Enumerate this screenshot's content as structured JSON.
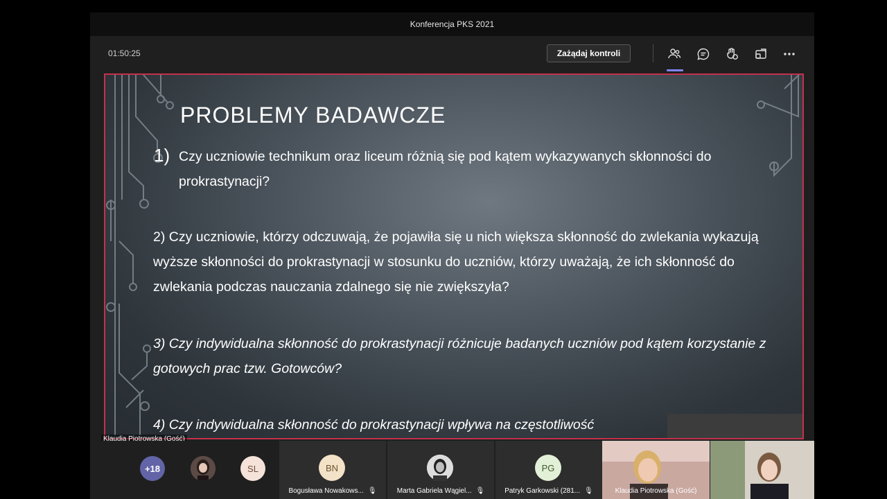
{
  "window": {
    "title": "Konferencja PKS 2021"
  },
  "toolbar": {
    "timer": "01:50:25",
    "request_control_label": "Zażądaj kontroli",
    "icons": [
      "people-icon",
      "chat-icon",
      "reactions-icon",
      "share-tray-icon",
      "more-icon"
    ]
  },
  "slide": {
    "title": "PROBLEMY BADAWCZE",
    "q1_number": "1)",
    "q1_text": "Czy uczniowie technikum oraz liceum różnią się pod kątem wykazywanych skłonności do prokrastynacji?",
    "q2_text": "2) Czy uczniowie, którzy odczuwają, że pojawiła się u nich większa skłonność do zwlekania wykazują wyższe skłonności do prokrastynacji w stosunku do uczniów, którzy uważają, że ich skłonność do zwlekania podczas nauczania zdalnego się nie zwiększyła?",
    "q3_text": "3)  Czy indywidualna skłonność do prokrastynacji różnicuje badanych uczniów pod kątem korzystanie z gotowych prac tzw. Gotowców?",
    "q4_text": "4) Czy indywidualna skłonność do prokrastynacji wpływa na częstotliwość"
  },
  "presenter_name": "Klaudia Piotrowska (Gość)",
  "participants": {
    "more_count": "+18",
    "sl_initials": "SL",
    "tiles": [
      {
        "initials": "BN",
        "name": "Bogusława Nowakows...",
        "color": "#f3e2c7"
      },
      {
        "initials": "",
        "name": "Marta Gabriela Wągiel...",
        "color": "#d9d9d9"
      },
      {
        "initials": "PG",
        "name": "Patryk Garkowski (281...",
        "color": "#e3f0d8"
      }
    ],
    "video_tiles": [
      {
        "name": "Klaudia Piotrowska (Gość)"
      },
      {
        "name": ""
      }
    ]
  }
}
